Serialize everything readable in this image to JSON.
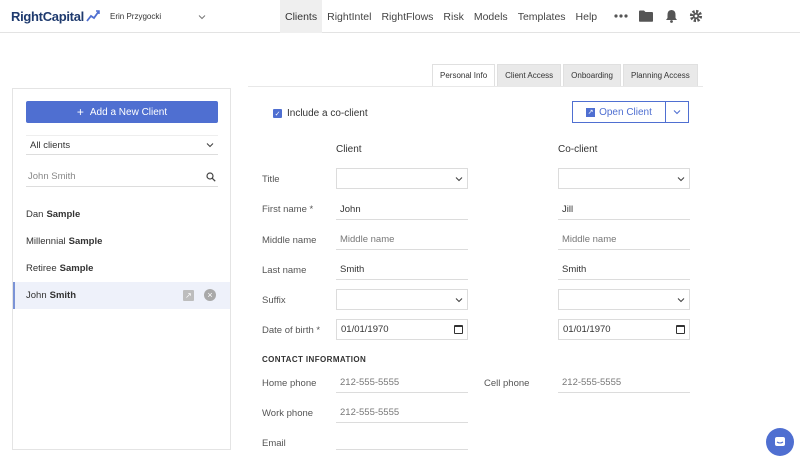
{
  "brand": {
    "logo_text": "RightCapital",
    "accent": "#4f6fd1",
    "brand_dark": "#1e3a6e"
  },
  "header": {
    "advisor_name": "Erin Przygocki",
    "nav": [
      {
        "label": "Clients",
        "active": true
      },
      {
        "label": "RightIntel"
      },
      {
        "label": "RightFlows"
      },
      {
        "label": "Risk"
      },
      {
        "label": "Models"
      },
      {
        "label": "Templates"
      },
      {
        "label": "Help"
      }
    ],
    "icons": [
      "more-icon",
      "folder-icon",
      "bell-icon",
      "gear-icon"
    ]
  },
  "sidebar": {
    "add_button": "Add a New Client",
    "filter": "All clients",
    "search_placeholder": "John Smith",
    "clients": [
      {
        "first": "Dan",
        "last": "Sample"
      },
      {
        "first": "Millennial",
        "last": "Sample"
      },
      {
        "first": "Retiree",
        "last": "Sample"
      },
      {
        "first": "John",
        "last": "Smith",
        "selected": true
      }
    ]
  },
  "tabs": [
    "Personal Info",
    "Client Access",
    "Onboarding",
    "Planning Access"
  ],
  "form": {
    "include_cocient_label": "Include a co-client",
    "include_coclient_checked": true,
    "open_client_label": "Open Client",
    "client_header": "Client",
    "coclient_header": "Co-client",
    "labels": {
      "title": "Title",
      "first_name": "First name *",
      "middle_name": "Middle name",
      "last_name": "Last name",
      "suffix": "Suffix",
      "dob": "Date of birth *"
    },
    "client": {
      "first_name": "John",
      "middle_name_placeholder": "Middle name",
      "last_name": "Smith",
      "dob": "01/01/1970"
    },
    "coclient": {
      "first_name": "Jill",
      "middle_name_placeholder": "Middle name",
      "last_name": "Smith",
      "dob": "01/01/1970"
    },
    "contact_section": "CONTACT INFORMATION",
    "home_phone_label": "Home phone",
    "home_phone": "212-555-5555",
    "cell_phone_label": "Cell phone",
    "cell_phone": "212-555-5555",
    "work_phone_label": "Work phone",
    "work_phone": "212-555-5555",
    "email_label": "Email"
  }
}
